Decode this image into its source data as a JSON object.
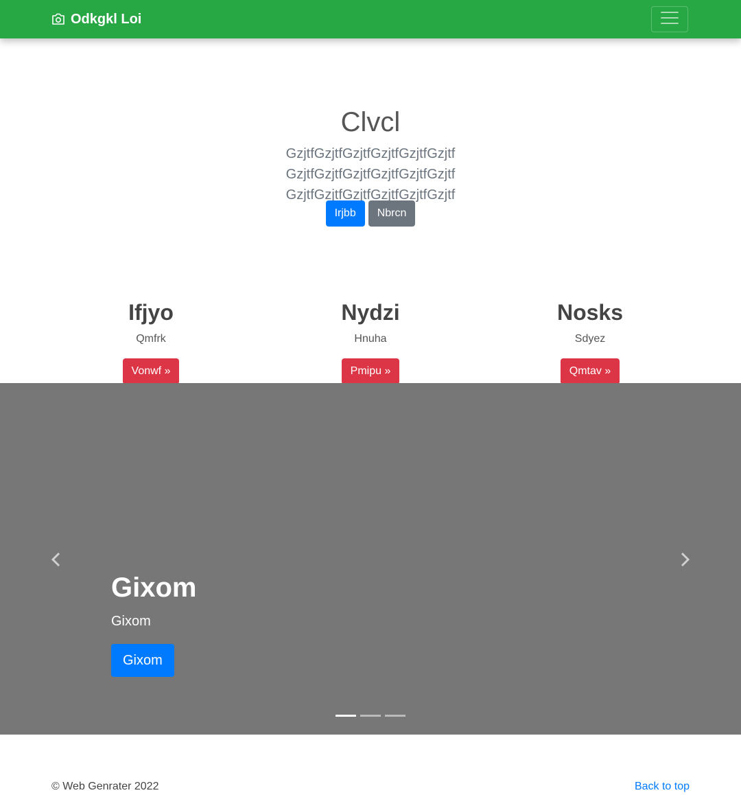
{
  "navbar": {
    "brand": "Odkgkl Loi",
    "brand_icon": "camera-icon",
    "toggler_icon": "hamburger-menu-icon"
  },
  "hero": {
    "title": "Clvcl",
    "lead": "GzjtfGzjtfGzjtfGzjtfGzjtfGzjtf GzjtfGzjtfGzjtfGzjtfGzjtfGzjtf GzjtfGzjtfGzjtfGzjtfGzjtfGzjtf",
    "primary_button": "Irjbb",
    "secondary_button": "Nbrcn"
  },
  "columns": [
    {
      "title": "Ifjyo",
      "text": "Qmfrk",
      "button": "Vonwf »"
    },
    {
      "title": "Nydzi",
      "text": "Hnuha",
      "button": "Pmipu »"
    },
    {
      "title": "Nosks",
      "text": "Sdyez",
      "button": "Qmtav »"
    }
  ],
  "carousel": {
    "caption_title": "Gixom",
    "caption_text": "Gixom",
    "caption_button": "Gixom",
    "prev_icon": "chevron-left-icon",
    "next_icon": "chevron-right-icon",
    "slide_count": 3,
    "active_slide": 1
  },
  "footer": {
    "copyright": "© Web Genrater 2022",
    "back_to_top": "Back to top"
  },
  "colors": {
    "navbar": "#28a745",
    "primary": "#007bff",
    "secondary": "#6c757d",
    "danger": "#dc3545",
    "carousel_bg": "#777777"
  }
}
